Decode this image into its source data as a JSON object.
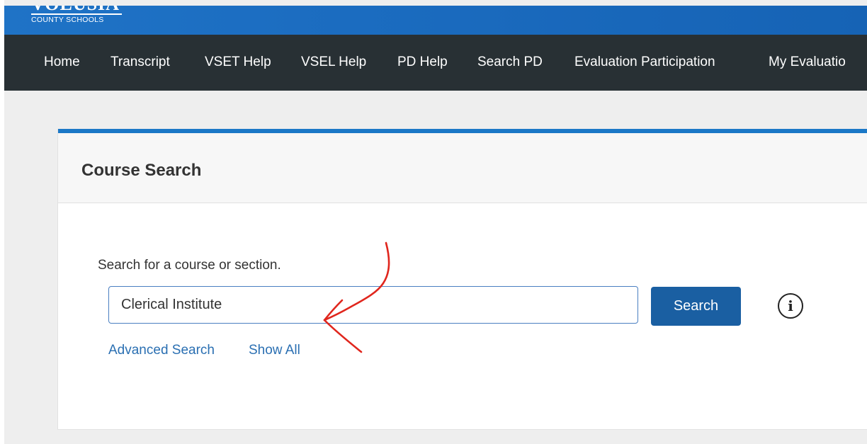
{
  "brand": {
    "logo_text": "VOLUSIA",
    "logo_subtext": "COUNTY SCHOOLS",
    "bar_color": "#1b6cc0"
  },
  "nav": {
    "background": "#283034",
    "items": [
      {
        "label": "Home"
      },
      {
        "label": "Transcript"
      },
      {
        "label": "VSET Help"
      },
      {
        "label": "VSEL Help"
      },
      {
        "label": "PD Help"
      },
      {
        "label": "Search PD"
      },
      {
        "label": "Evaluation Participation"
      },
      {
        "label": "My Evaluatio"
      }
    ]
  },
  "course_search": {
    "title": "Course Search",
    "prompt": "Search for a course or section.",
    "input_value": "Clerical Institute",
    "search_button_label": "Search",
    "info_icon": "info-icon",
    "links": {
      "advanced_search": "Advanced Search",
      "show_all": "Show All"
    },
    "accent_color": "#1b78c7",
    "button_color": "#1a5fa2"
  },
  "annotation": {
    "type": "hand-drawn-arrow",
    "color": "#e0261d"
  }
}
